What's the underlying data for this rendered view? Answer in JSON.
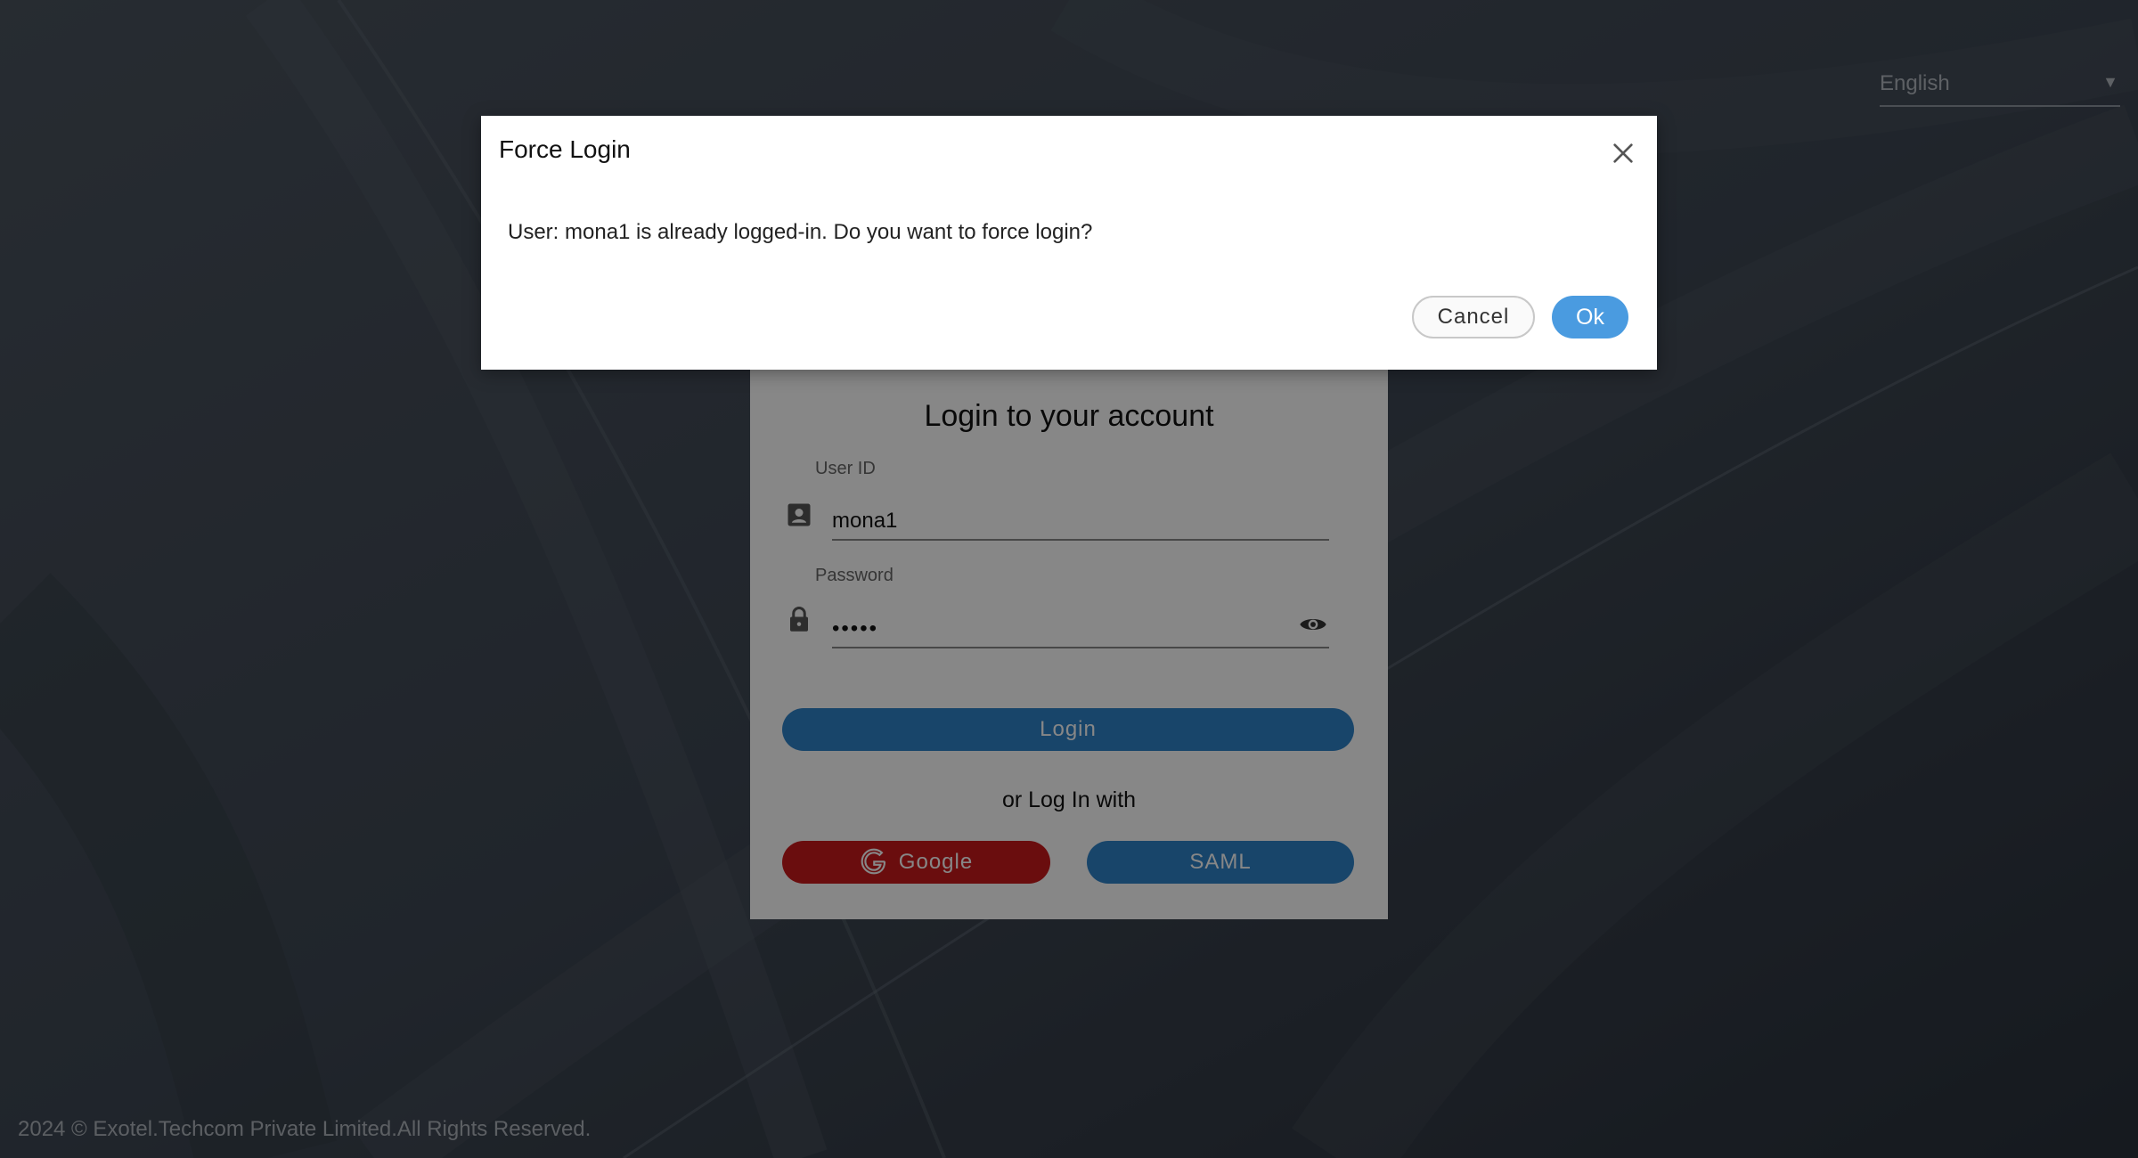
{
  "language": {
    "selected": "English"
  },
  "login": {
    "title": "Login to your account",
    "user_id_label": "User ID",
    "user_id_value": "mona1",
    "password_label": "Password",
    "password_masked": "•••••",
    "login_button": "Login",
    "or_text": "or Log In with",
    "google_button": "Google",
    "saml_button": "SAML"
  },
  "footer": {
    "text": "2024 © Exotel.Techcom Private Limited.All Rights Reserved."
  },
  "dialog": {
    "title": "Force Login",
    "message": "User: mona1 is already logged-in. Do you want to force login?",
    "cancel_label": "Cancel",
    "ok_label": "Ok"
  },
  "icons": {
    "close": "close-icon",
    "user": "user-icon",
    "lock": "lock-icon",
    "eye": "eye-icon",
    "google": "google-icon",
    "dropdown": "chevron-down-icon"
  },
  "colors": {
    "primary_blue": "#2f82c9",
    "ok_blue": "#4a9be0",
    "google_red": "#c8191c",
    "background": "#3b4450"
  }
}
